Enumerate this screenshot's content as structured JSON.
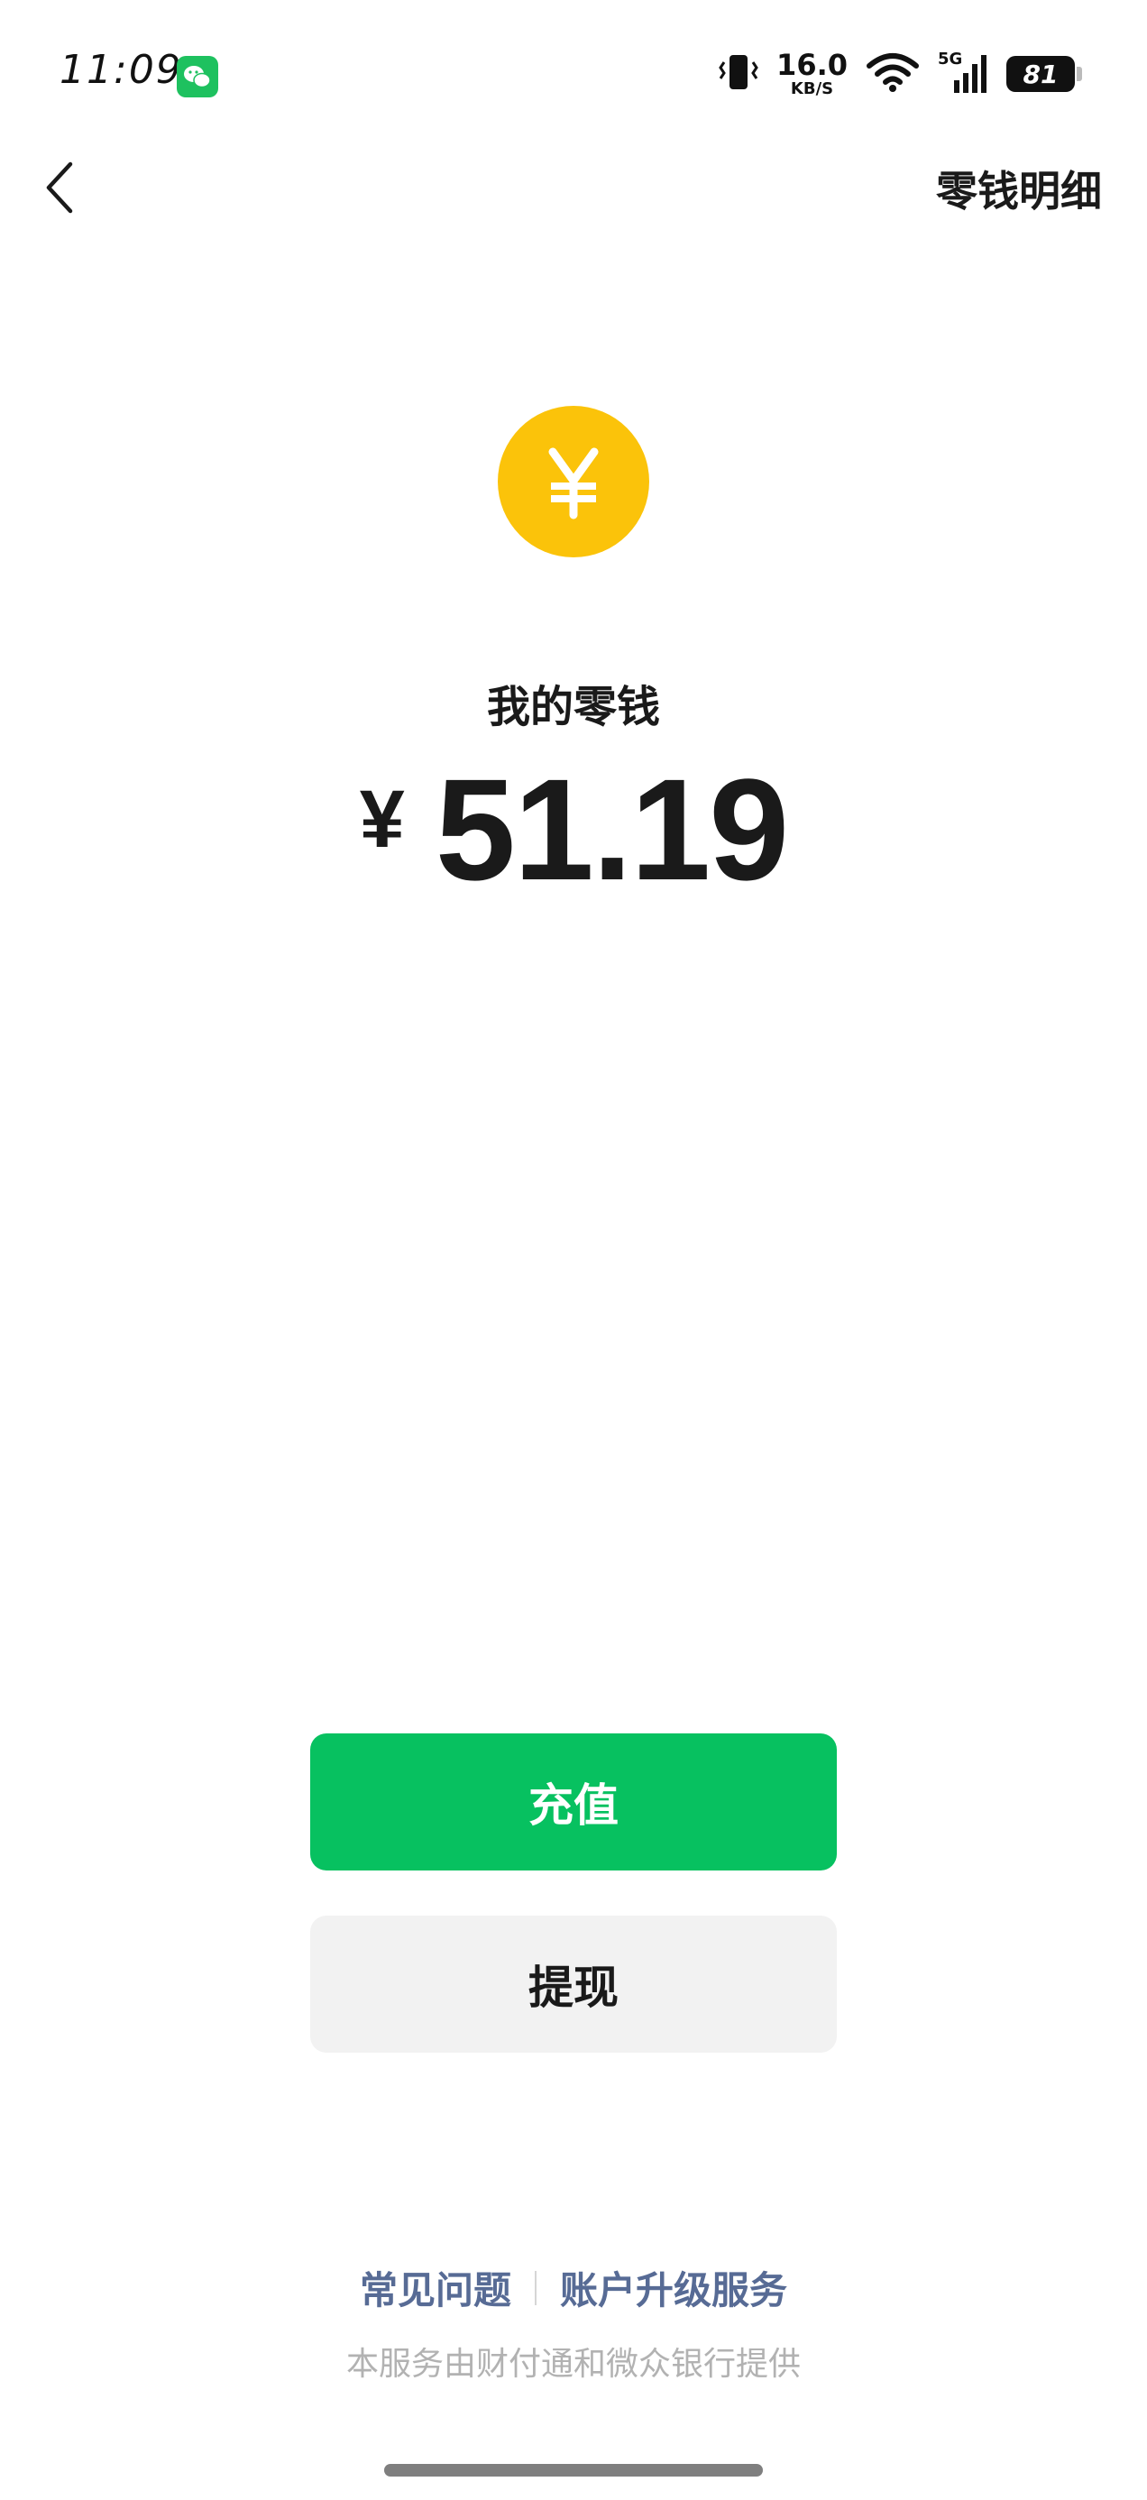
{
  "status_bar": {
    "time": "11:09",
    "net_speed_value": "16.0",
    "net_speed_unit": "KB/S",
    "network_type": "5G",
    "battery": "81",
    "icons": [
      "wechat-icon",
      "vibrate-icon",
      "wifi-icon",
      "signal-icon",
      "battery-icon"
    ]
  },
  "nav": {
    "back_icon": "chevron-left-icon",
    "right_link": "零钱明细"
  },
  "balance": {
    "coin_icon": "yuan-coin-icon",
    "label": "我的零钱",
    "currency": "¥",
    "amount": "51.19"
  },
  "actions": {
    "topup_label": "充值",
    "withdraw_label": "提现"
  },
  "footer": {
    "faq_link": "常见问题",
    "upgrade_link": "账户升级服务",
    "provider_text": "本服务由财付通和微众银行提供"
  },
  "colors": {
    "primary_green": "#07c160",
    "coin_yellow": "#fbc30a",
    "link_blue": "#576b95",
    "muted_gray": "#b2b2b2",
    "button_gray": "#f2f2f2"
  }
}
